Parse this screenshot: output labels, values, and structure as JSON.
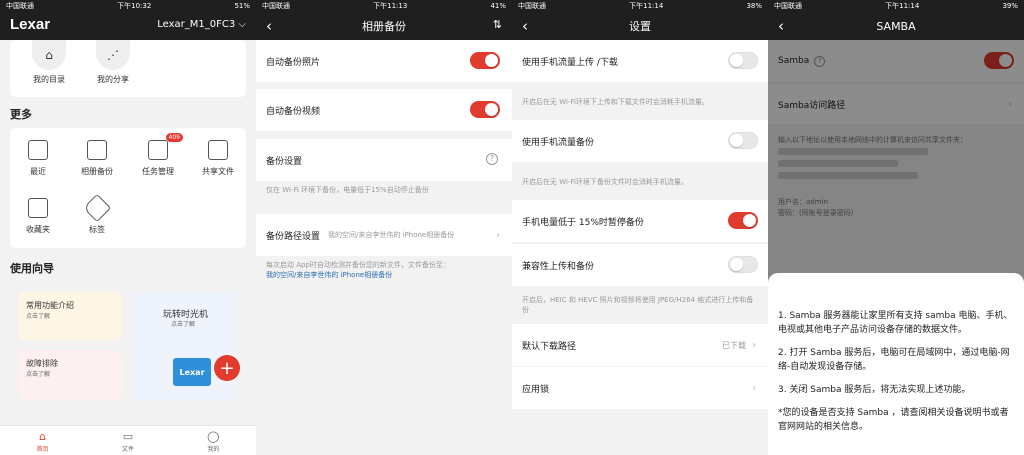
{
  "status": [
    {
      "carrier": "中国联通",
      "time": "下午10:32",
      "battery": "51%"
    },
    {
      "carrier": "中国联通",
      "time": "下午11:13",
      "battery": "41%"
    },
    {
      "carrier": "中国联通",
      "time": "下午11:14",
      "battery": "38%"
    },
    {
      "carrier": "中国联通",
      "time": "下午11:14",
      "battery": "39%"
    }
  ],
  "home": {
    "brand": "Lexar",
    "device": "Lexar_M1_0FC3",
    "shortcuts": [
      "我的目录",
      "我的分享"
    ],
    "more_title": "更多",
    "grid": [
      {
        "label": "最近",
        "icon": "calendar-icon"
      },
      {
        "label": "相册备份",
        "icon": "photo-icon"
      },
      {
        "label": "任务管理",
        "icon": "task-icon",
        "badge": "409"
      },
      {
        "label": "共享文件",
        "icon": "share-network-icon"
      },
      {
        "label": "收藏夹",
        "icon": "star-icon"
      },
      {
        "label": "标签",
        "icon": "tag-icon"
      }
    ],
    "guide_title": "使用向导",
    "guides": [
      {
        "title": "常用功能介绍",
        "sub": "点击了解"
      },
      {
        "title": "玩转时光机",
        "sub": "点击了解"
      },
      {
        "title": "故障排除",
        "sub": "点击了解"
      }
    ],
    "illustration_text": "Lexar",
    "tabs": [
      "首页",
      "文件",
      "我的"
    ]
  },
  "backup": {
    "title": "相册备份",
    "auto_photo": "自动备份照片",
    "auto_video": "自动备份视频",
    "settings": "备份设置",
    "settings_note": "仅在 Wi-Fi 环境下备份，电量低于15%自动停止备份",
    "path_label": "备份路径设置",
    "path_value": "我的空间/来自李世伟的 iPhone相册备份",
    "path_note": "每次启动 App时自动检测并备份您的新文件，文件备份至：",
    "path_note_link": "我的空间/来自李世伟的 iPhone相册备份"
  },
  "settings": {
    "title": "设置",
    "items": [
      {
        "label": "使用手机流量上传 /下载",
        "note": "开启后在无 Wi-Fi环境下上传和下载文件时会消耗手机流量。"
      },
      {
        "label": "使用手机流量备份",
        "note": "开启后在无 Wi-Fi环境下备份文件时会消耗手机流量。"
      },
      {
        "label": "手机电量低于 15%时暂停备份"
      },
      {
        "label": "兼容性上传和备份",
        "note": "开启后，HEIC 和 HEVC 照片和视频将使用 JPEG/H264 格式进行上传和备份"
      },
      {
        "label": "默认下载路径",
        "value": "已下载"
      },
      {
        "label": "应用锁"
      }
    ]
  },
  "samba": {
    "title": "SAMBA",
    "toggle_label": "Samba",
    "access_path": "Samba访问路径",
    "info": "输入以下地址以使用本地网络中的计算机来访问共享文件夹：",
    "user": "用户名：admin",
    "password": "密码：(同账号登录密码)",
    "sheet": [
      "1. Samba 服务器能让家里所有支持 samba 电脑、手机、电视或其他电子产品访问设备存储的数据文件。",
      "2. 打开 Samba 服务后，电脑可在局域网中，通过电脑-网络-自动发现设备存储。",
      "3. 关闭 Samba 服务后，将无法实现上述功能。",
      "*您的设备是否支持 Samba ，请查阅相关设备说明书或者官网网站的相关信息。"
    ]
  },
  "colors": {
    "accent": "#e03b2c",
    "dark": "#1f1f1f"
  }
}
